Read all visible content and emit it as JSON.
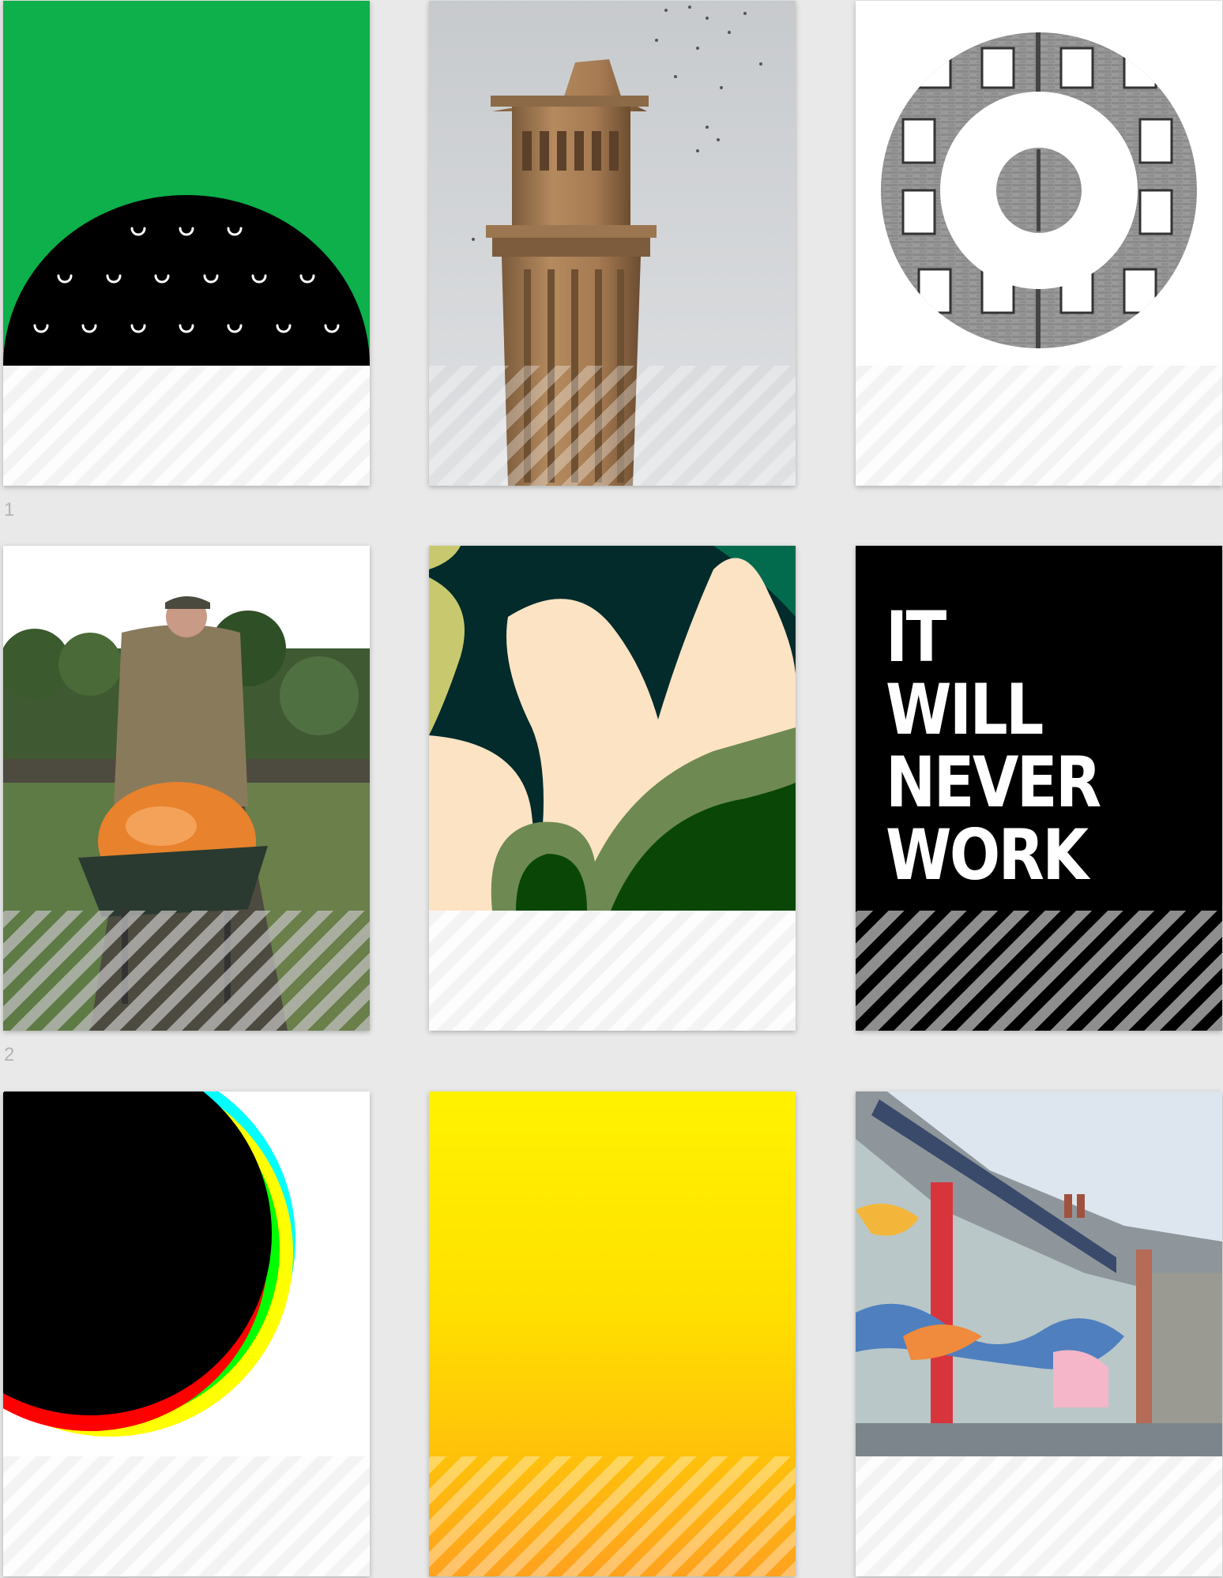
{
  "rows": [
    {
      "number": "1"
    },
    {
      "number": "2"
    }
  ],
  "cards": {
    "slogan": {
      "lines": [
        "IT",
        "WILL",
        "NEVER",
        "WORK"
      ]
    }
  },
  "colors": {
    "page_background": "#e9e9e9",
    "green": "#0db04b",
    "dark_teal": "#032b2b",
    "cream": "#fce3c4",
    "olive": "#6e8a52",
    "forest": "#0a4707",
    "yellow": "#fff200",
    "orange": "#ffa11f",
    "red": "#ff0000",
    "cyan": "#00ffff"
  }
}
